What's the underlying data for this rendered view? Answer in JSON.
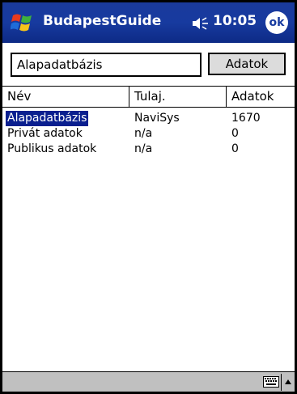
{
  "titlebar": {
    "app_title": "BudapestGuide",
    "time": "10:05",
    "ok_label": "ok"
  },
  "search": {
    "value": "Alapadatbázis",
    "button_label": "Adatok"
  },
  "table": {
    "columns": [
      "Név",
      "Tulaj.",
      "Adatok"
    ],
    "rows": [
      {
        "name": "Alapadatbázis",
        "owner": "NaviSys",
        "count": "1670",
        "selected": true
      },
      {
        "name": "Privát adatok",
        "owner": "n/a",
        "count": "0",
        "selected": false
      },
      {
        "name": "Publikus adatok",
        "owner": "n/a",
        "count": "0",
        "selected": false
      }
    ]
  },
  "colors": {
    "titlebar": "#173a9f",
    "selection": "#0a1f8f",
    "toolbar": "#c0c0c0"
  },
  "icons": {
    "start": "windows-flag-icon",
    "volume": "speaker-icon",
    "keyboard": "keyboard-icon",
    "sip_toggle": "up-arrow-icon"
  }
}
